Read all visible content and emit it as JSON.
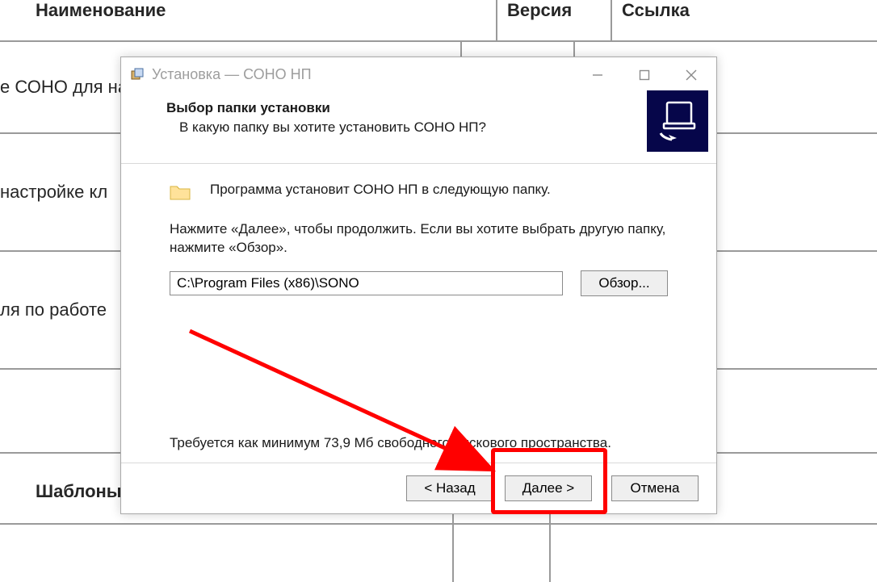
{
  "table": {
    "headers": {
      "name": "Наименование",
      "version": "Версия",
      "link": "Ссылка"
    },
    "rows": [
      {
        "name": "е СОНО для на"
      },
      {
        "name": "настройке кл"
      },
      {
        "name": "ля по работе"
      }
    ],
    "subheader": "Шаблоны"
  },
  "installer": {
    "title": "Установка — СОНО НП",
    "header": {
      "title": "Выбор папки установки",
      "subtitle": "В какую папку вы хотите установить СОНО НП?"
    },
    "body": {
      "intro": "Программа установит СОНО НП в следующую папку.",
      "instruction": "Нажмите «Далее», чтобы продолжить. Если вы хотите выбрать другую папку, нажмите «Обзор».",
      "path": "C:\\Program Files (x86)\\SONO",
      "browse": "Обзор...",
      "disk_required": "Требуется как минимум 73,9 Мб свободного дискового пространства."
    },
    "footer": {
      "back": "< Назад",
      "next": "Далее >",
      "cancel": "Отмена"
    }
  }
}
